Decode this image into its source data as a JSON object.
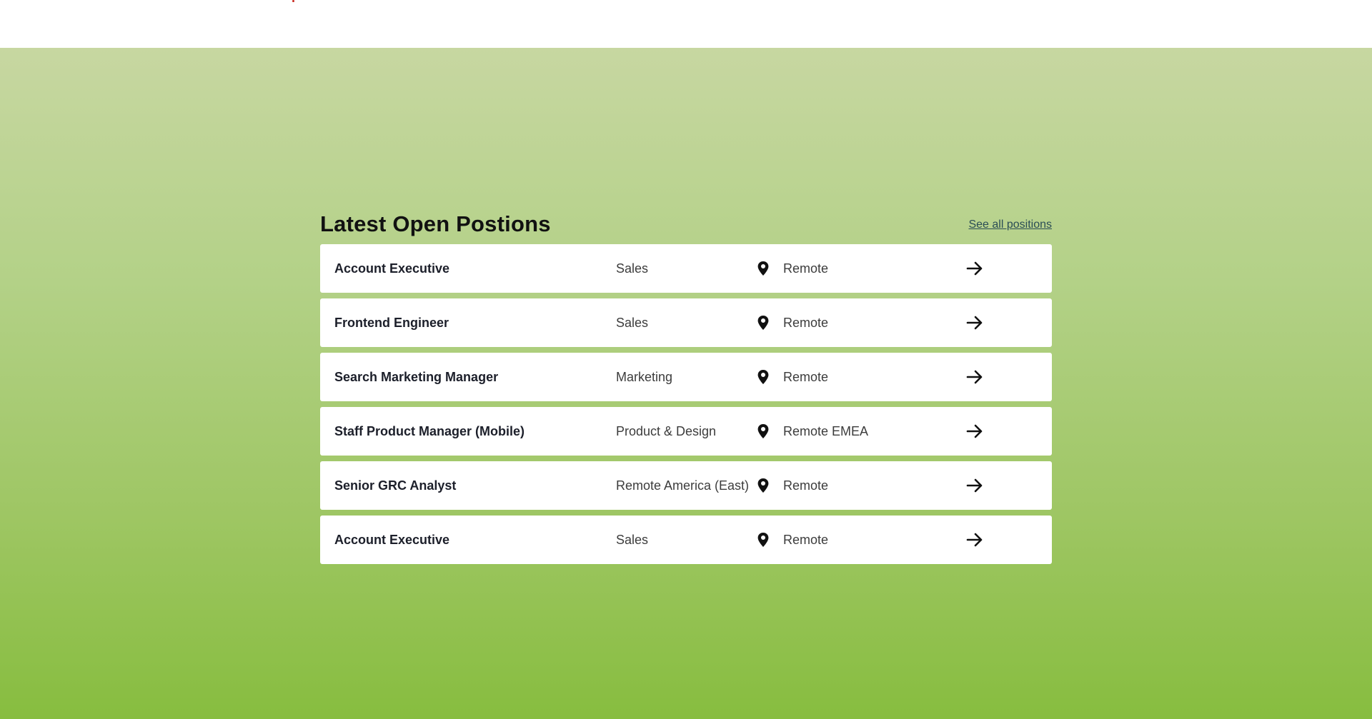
{
  "section": {
    "title": "Latest Open Postions",
    "see_all_label": "See all positions"
  },
  "jobs": [
    {
      "title": "Account Executive",
      "department": "Sales",
      "location": "Remote",
      "location_icon": "map-pin-icon",
      "action_icon": "arrow-right-icon"
    },
    {
      "title": "Frontend Engineer",
      "department": "Sales",
      "location": "Remote",
      "location_icon": "map-pin-icon",
      "action_icon": "arrow-right-icon"
    },
    {
      "title": "Search Marketing Manager",
      "department": "Marketing",
      "location": "Remote",
      "location_icon": "map-pin-icon",
      "action_icon": "arrow-right-icon"
    },
    {
      "title": "Staff Product Manager (Mobile)",
      "department": "Product & Design",
      "location": "Remote EMEA",
      "location_icon": "map-pin-icon",
      "action_icon": "arrow-right-icon"
    },
    {
      "title": "Senior GRC Analyst",
      "department": "Remote America (East)",
      "location": "Remote",
      "location_icon": "map-pin-icon",
      "action_icon": "arrow-right-icon"
    },
    {
      "title": "Account Executive",
      "department": "Sales",
      "location": "Remote",
      "location_icon": "map-pin-icon",
      "action_icon": "arrow-right-icon"
    }
  ],
  "colors": {
    "hero_gradient_top": "#c7d7a1",
    "hero_gradient_bottom": "#87bd3f",
    "link": "#2a4d55"
  }
}
